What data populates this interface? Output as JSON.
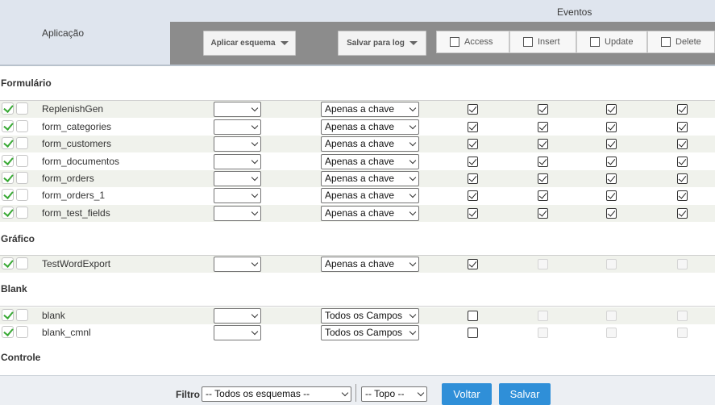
{
  "header": {
    "app_label": "Aplicação",
    "events_label": "Eventos",
    "apply_scheme": "Aplicar esquema",
    "save_log": "Salvar para log",
    "events": [
      "Access",
      "Insert",
      "Update",
      "Delete"
    ]
  },
  "sections": {
    "formulario": "Formulário",
    "grafico": "Gráfico",
    "blank": "Blank",
    "controle": "Controle"
  },
  "rows": [
    {
      "name": "ReplenishGen",
      "mode": "Apenas a chave",
      "access": true,
      "insert": true,
      "update": true,
      "delete": true
    },
    {
      "name": "form_categories",
      "mode": "Apenas a chave",
      "access": true,
      "insert": true,
      "update": true,
      "delete": true
    },
    {
      "name": "form_customers",
      "mode": "Apenas a chave",
      "access": true,
      "insert": true,
      "update": true,
      "delete": true
    },
    {
      "name": "form_documentos",
      "mode": "Apenas a chave",
      "access": true,
      "insert": true,
      "update": true,
      "delete": true
    },
    {
      "name": "form_orders",
      "mode": "Apenas a chave",
      "access": true,
      "insert": true,
      "update": true,
      "delete": true
    },
    {
      "name": "form_orders_1",
      "mode": "Apenas a chave",
      "access": true,
      "insert": true,
      "update": true,
      "delete": true
    },
    {
      "name": "form_test_fields",
      "mode": "Apenas a chave",
      "access": true,
      "insert": true,
      "update": true,
      "delete": true
    },
    {
      "name": "TestWordExport",
      "mode": "Apenas a chave",
      "access": true,
      "insert": false,
      "update": false,
      "delete": false
    },
    {
      "name": "blank",
      "mode": "Todos os Campos",
      "access": false,
      "insert": false,
      "update": false,
      "delete": false
    },
    {
      "name": "blank_cmnl",
      "mode": "Todos os Campos",
      "access": false,
      "insert": false,
      "update": false,
      "delete": false
    }
  ],
  "footer": {
    "filter_label": "Filtro",
    "scheme_filter": "-- Todos os esquemas --",
    "position_filter": "-- Topo --",
    "back": "Voltar",
    "save": "Salvar"
  }
}
